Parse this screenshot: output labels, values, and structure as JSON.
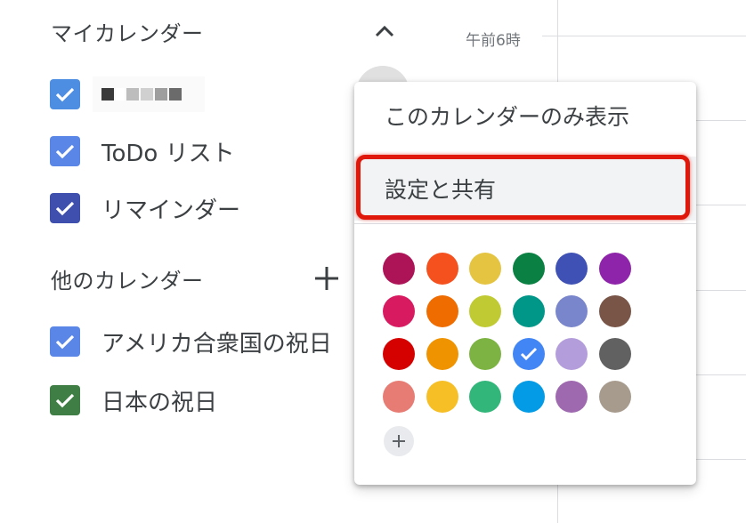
{
  "sidebar": {
    "my_calendars": {
      "title": "マイカレンダー",
      "collapse_icon": "chevron-up-icon",
      "items": [
        {
          "label": "",
          "color": "#4285f4",
          "checked": true,
          "redacted": true
        },
        {
          "label": "ToDo リスト",
          "color": "#5484ed",
          "checked": true
        },
        {
          "label": "リマインダー",
          "color": "#3f51b5",
          "checked": true
        }
      ]
    },
    "other_calendars": {
      "title": "他のカレンダー",
      "add_icon": "plus-icon",
      "items": [
        {
          "label": "アメリカ合衆国の祝日",
          "color": "#4285f4",
          "checked": true
        },
        {
          "label": "日本の祝日",
          "color": "#33b679",
          "checked": true
        }
      ]
    }
  },
  "grid": {
    "time_label": "午前6時"
  },
  "menu": {
    "items": [
      {
        "label": "このカレンダーのみ表示",
        "highlighted": false
      },
      {
        "label": "設定と共有",
        "highlighted": true
      }
    ],
    "color_rows": [
      [
        "#ad1457",
        "#f4511e",
        "#e4c441",
        "#0b8043",
        "#3f51b5",
        "#8e24aa"
      ],
      [
        "#d81b60",
        "#ef6c00",
        "#c0ca33",
        "#009688",
        "#7986cb",
        "#795548"
      ],
      [
        "#d50000",
        "#f09300",
        "#7cb342",
        "#4285f4",
        "#b39ddb",
        "#616161"
      ],
      [
        "#e67c73",
        "#f6bf26",
        "#33b679",
        "#039be5",
        "#9e69af",
        "#a79b8e"
      ]
    ],
    "selected_color": "#4285f4",
    "add_color_icon": "plus-icon"
  }
}
